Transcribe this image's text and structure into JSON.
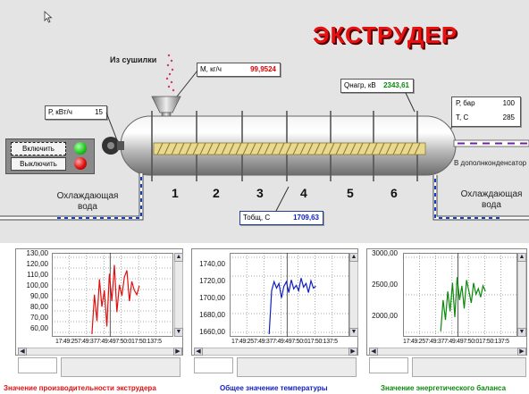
{
  "title": "ЭКСТРУДЕР",
  "from_dryer_label": "Из сушилки",
  "mass_flow": {
    "label": "М, кг/ч",
    "value": "99,9524",
    "color": "#e00000"
  },
  "power": {
    "label": "Р, кВт/ч",
    "value": "15"
  },
  "q_load": {
    "label": "Qнагр, кВ",
    "value": "2343,61",
    "color": "#0a8a0a"
  },
  "outlet": {
    "p_label": "Р, бар",
    "p_value": "100",
    "t_label": "Т, С",
    "t_value": "285"
  },
  "t_total": {
    "label": "Тобщ, С",
    "value": "1709,63",
    "color": "#1020c0"
  },
  "to_condenser_label": "В дополнконденсатор",
  "buttons": {
    "on": "Включить",
    "off": "Выключить"
  },
  "lamps": {
    "on_color": "#22cc22",
    "off_color": "#e01010"
  },
  "zones": [
    "1",
    "2",
    "3",
    "4",
    "5",
    "6"
  ],
  "cooling_water_left": "Охлаждающая\nвода",
  "cooling_water_right": "Охлаждающая\nвода",
  "chart_data": [
    {
      "type": "line",
      "title": "Значение производительности экструдера",
      "title_color": "#e01010",
      "series_color": "#e01010",
      "y_ticks": [
        "130,00",
        "120,00",
        "110,00",
        "100,00",
        "90,00",
        "80,00",
        "70,00",
        "60,00"
      ],
      "ylim": [
        60,
        130
      ],
      "x_ticks_text": "17:49:257:49:377:49:497:50:017:50:137:5",
      "series": [
        {
          "values": [
            60,
            96,
            72,
            110,
            85,
            100,
            67,
            115,
            90,
            123,
            80,
            105,
            95,
            112,
            118,
            90,
            108,
            100,
            96,
            104
          ]
        }
      ]
    },
    {
      "type": "line",
      "title": "Общее значение температуры",
      "title_color": "#1020c0",
      "series_color": "#1020c0",
      "y_ticks": [
        "1740,00",
        "1720,00",
        "1700,00",
        "1680,00",
        "1660,00"
      ],
      "ylim": [
        1660,
        1745
      ],
      "x_ticks_text": "17:49:257:49:377:49:497:50:017:50:137:5",
      "series": [
        {
          "values": [
            1660,
            1708,
            1718,
            1711,
            1716,
            1700,
            1713,
            1718,
            1706,
            1720,
            1710,
            1714,
            1708,
            1722,
            1712,
            1716,
            1706,
            1719,
            1711,
            1713
          ]
        }
      ]
    },
    {
      "type": "line",
      "title": "Значение энергетического баланса",
      "title_color": "#0a8a0a",
      "series_color": "#0a8a0a",
      "y_ticks": [
        "3000,00",
        "2500,00",
        "2000,00"
      ],
      "ylim": [
        1650,
        3000
      ],
      "x_ticks_text": "17:49:257:49:377:49:497:50:017:50:137:5",
      "series": [
        {
          "values": [
            1700,
            2250,
            1900,
            2400,
            2050,
            2550,
            1950,
            2650,
            2250,
            2500,
            2100,
            2600,
            2400,
            2200,
            2550,
            2350,
            2450,
            2300,
            2500,
            2400
          ]
        }
      ]
    }
  ]
}
